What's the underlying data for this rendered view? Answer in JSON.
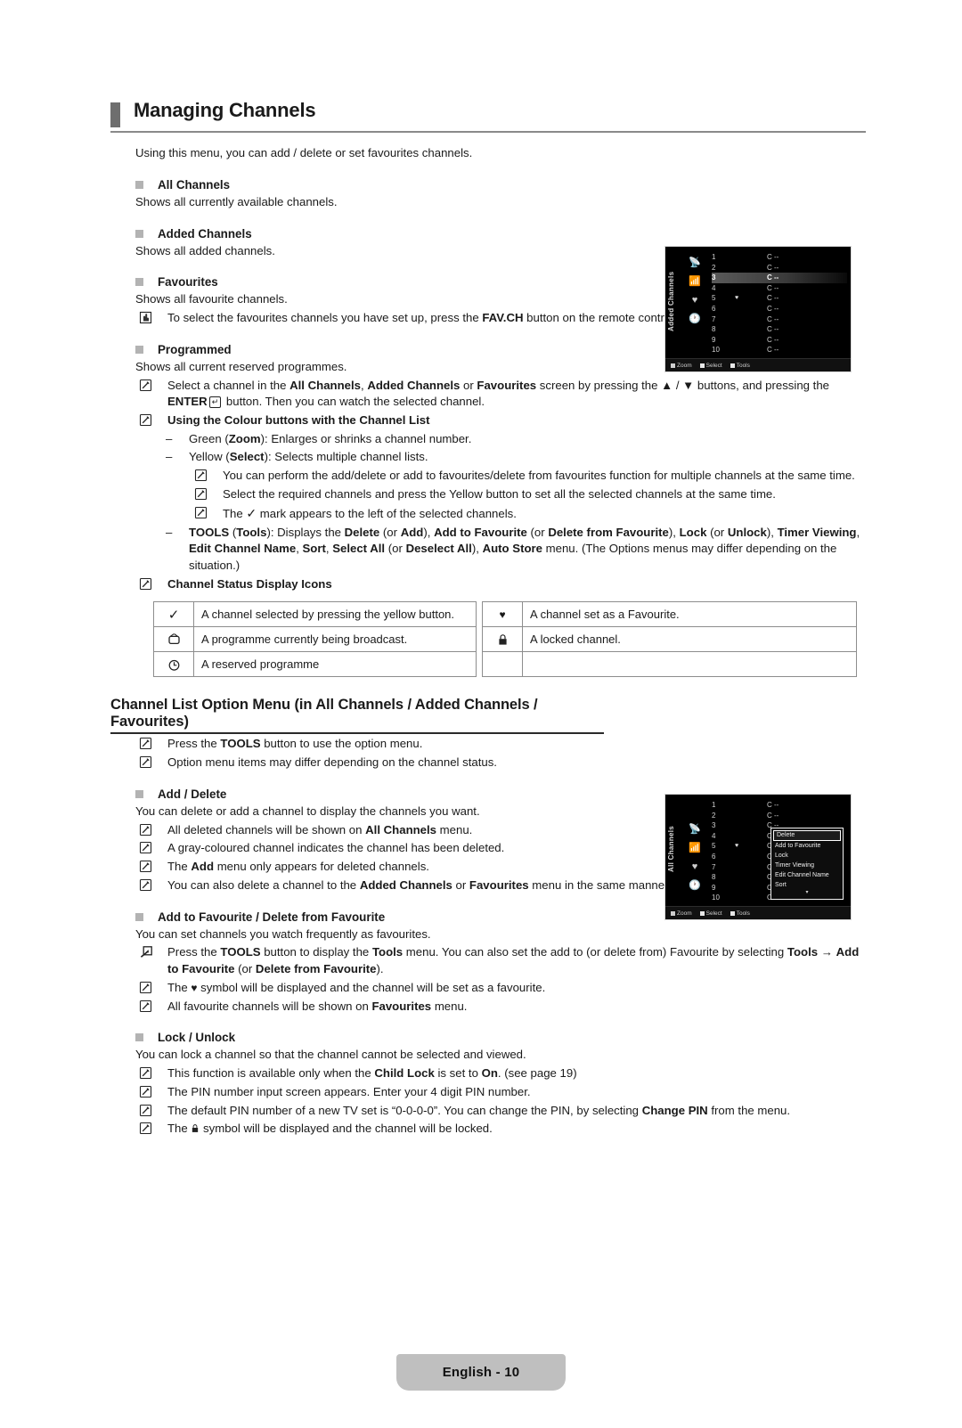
{
  "header": {
    "title": "Managing Channels"
  },
  "intro": "Using this menu, you can add / delete or set favourites channels.",
  "sections": {
    "all_channels": {
      "heading": "All Channels",
      "body": "Shows all currently available channels."
    },
    "added_channels": {
      "heading": "Added Channels",
      "body": "Shows all added channels."
    },
    "favourites": {
      "heading": "Favourites",
      "body": "Shows all favourite channels.",
      "note": "To select the favourites channels you have set up, press the FAV.CH button on the remote control."
    },
    "programmed": {
      "heading": "Programmed",
      "body": "Shows all current reserved programmes.",
      "note_select_channel": "Select a channel in the All Channels, Added Channels or Favourites screen by pressing the ▲ / ▼ buttons, and pressing the ENTER button. Then you can watch the selected channel.",
      "colour_buttons_heading": "Using the Colour buttons with the Channel List",
      "green_zoom": "Green (Zoom): Enlarges or shrinks a channel number.",
      "yellow_select": "Yellow (Select): Selects multiple channel lists.",
      "yellow_note_1": "You can perform the add/delete or add to favourites/delete from favourites function for multiple channels at the same time.",
      "yellow_note_2": "Select the required channels and press the Yellow button to set all the selected channels at the same time.",
      "yellow_note_3": "The ✓ mark appears to the left of the selected channels.",
      "tools_line": "TOOLS (Tools): Displays the Delete (or Add), Add to Favourite (or Delete from Favourite), Lock (or Unlock), Timer Viewing, Edit Channel Name, Sort, Select All (or Deselect All), Auto Store menu. (The Options menus may differ depending on the situation.)",
      "status_icons_heading": "Channel Status Display Icons"
    }
  },
  "status_table": {
    "rows": [
      {
        "left_icon": "check-icon",
        "left_text": "A channel selected by pressing the yellow button.",
        "right_icon": "heart-icon",
        "right_text": "A channel set as a Favourite."
      },
      {
        "left_icon": "tv-icon",
        "left_text": "A programme currently being broadcast.",
        "right_icon": "lock-icon",
        "right_text": "A locked channel."
      },
      {
        "left_icon": "clock-icon",
        "left_text": "A reserved programme",
        "right_icon": "",
        "right_text": ""
      }
    ]
  },
  "option_menu": {
    "heading": "Channel List Option Menu (in All Channels / Added Channels / Favourites)",
    "note_1": "Press the TOOLS button to use the option menu.",
    "note_2": "Option menu items may differ depending on the channel status.",
    "add_delete": {
      "heading": "Add / Delete",
      "body": "You can delete or add a channel to display the channels you want.",
      "notes": [
        "All deleted channels will be shown on All Channels menu.",
        "A gray-coloured channel indicates the channel has been deleted.",
        "The Add menu only appears for deleted channels.",
        "You can also delete a channel to the Added Channels or Favourites menu in the same manner."
      ]
    },
    "add_favourite": {
      "heading": "Add to Favourite / Delete from Favourite",
      "body": "You can set channels you watch frequently as favourites.",
      "tools_note": "Press the TOOLS button to display the Tools menu. You can also set the add to (or delete from) Favourite by selecting Tools → Add to Favourite (or Delete from Favourite).",
      "notes": [
        "The ♥ symbol will be displayed and the channel will be set as a favourite.",
        "All favourite channels will be shown on Favourites menu."
      ]
    },
    "lock_unlock": {
      "heading": "Lock / Unlock",
      "body": "You can lock a channel so that the channel cannot be selected and viewed.",
      "notes": [
        "This function is available only when the Child Lock is set to On. (see page 19)",
        "The PIN number input screen appears. Enter your 4 digit PIN number.",
        "The default PIN number of a new TV set is “0-0-0-0”. You can change the PIN, by selecting Change PIN from the menu.",
        "The ■ symbol will be displayed and the channel will be locked."
      ]
    }
  },
  "tv_added": {
    "label": "Added Channels",
    "rows": [
      {
        "num": "1",
        "cc": "C --",
        "fav": ""
      },
      {
        "num": "2",
        "cc": "C --",
        "fav": ""
      },
      {
        "num": "3",
        "cc": "C --",
        "fav": "",
        "selected": true
      },
      {
        "num": "4",
        "cc": "C --",
        "fav": ""
      },
      {
        "num": "5",
        "cc": "C --",
        "fav": "♥"
      },
      {
        "num": "6",
        "cc": "C --",
        "fav": ""
      },
      {
        "num": "7",
        "cc": "C --",
        "fav": ""
      },
      {
        "num": "8",
        "cc": "C --",
        "fav": ""
      },
      {
        "num": "9",
        "cc": "C --",
        "fav": ""
      },
      {
        "num": "10",
        "cc": "C --",
        "fav": ""
      }
    ],
    "footbar": [
      "Zoom",
      "Select",
      "Tools"
    ]
  },
  "tv_all": {
    "label": "All Channels",
    "rows": [
      {
        "num": "1",
        "cc": "C --",
        "fav": ""
      },
      {
        "num": "2",
        "cc": "C --",
        "fav": ""
      },
      {
        "num": "3",
        "cc": "C --",
        "fav": ""
      },
      {
        "num": "4",
        "cc": "C --",
        "fav": ""
      },
      {
        "num": "5",
        "cc": "C --",
        "fav": "♥"
      },
      {
        "num": "6",
        "cc": "C --",
        "fav": ""
      },
      {
        "num": "7",
        "cc": "C --",
        "fav": ""
      },
      {
        "num": "8",
        "cc": "C --",
        "fav": ""
      },
      {
        "num": "9",
        "cc": "C --",
        "fav": ""
      },
      {
        "num": "10",
        "cc": "C --",
        "fav": ""
      }
    ],
    "popup": {
      "items": [
        "Delete",
        "Add to Favourite",
        "Lock",
        "Timer Viewing",
        "Edit Channel Name",
        "Sort"
      ],
      "selected": "Delete"
    },
    "footbar": [
      "Zoom",
      "Select",
      "Tools"
    ]
  },
  "footer": {
    "page_label": "English - 10"
  },
  "colors": {
    "header_tab": "#6e6e6e",
    "bullet_square": "#b3b3b3",
    "rule": "#8a8a8a",
    "footer_pill": "#bfbfbf",
    "text": "#1a1a1a"
  }
}
